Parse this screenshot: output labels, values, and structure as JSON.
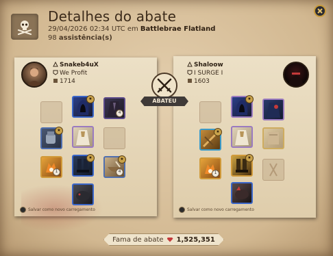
{
  "header": {
    "title": "Detalhes do abate",
    "timestamp": "29/04/2026 02:34 UTC em",
    "location": "Battlebrae Flatland",
    "assist_count": "98",
    "assist_label": "assistência(s)"
  },
  "center": {
    "banner": "ABATEU",
    "icon": "crossed-swords-icon"
  },
  "killer": {
    "name": "Snakeb4uX",
    "guild": "We Profit",
    "ip": "1714",
    "save_label": "Salvar como novo carregamento"
  },
  "victim": {
    "name": "Shaloow",
    "guild": "I SURGE I",
    "ip": "1603",
    "save_label": "Salvar como novo carregamento"
  },
  "footer": {
    "fame_label": "Fama de abate",
    "fame_value": "1,525,351"
  },
  "colors": {
    "paper": "#e8d9bd",
    "panel": "#d9c2a0",
    "banner": "#3f3a38",
    "gem": "#c43a3a"
  }
}
